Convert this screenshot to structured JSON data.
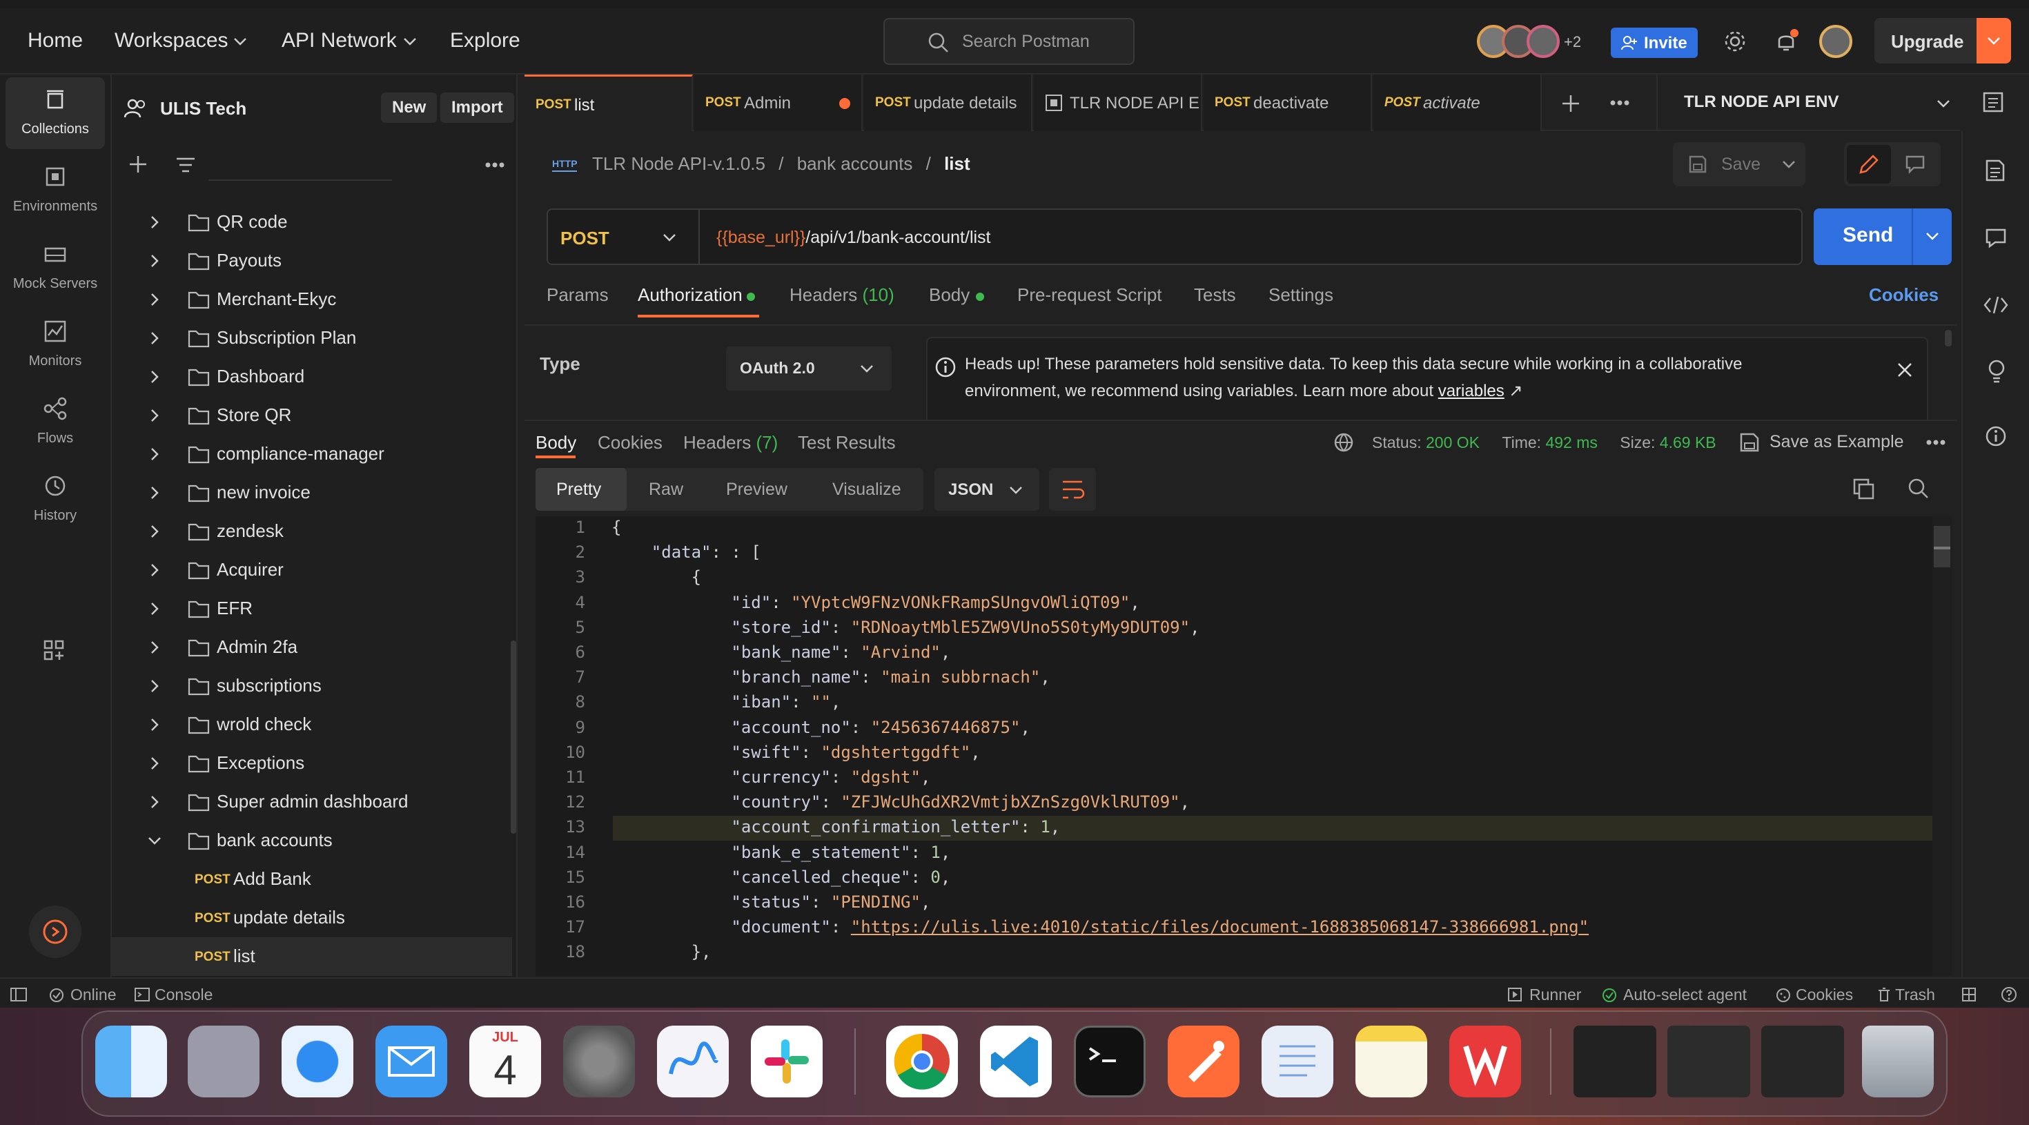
{
  "topnav": {
    "home": "Home",
    "workspaces": "Workspaces",
    "api_network": "API Network",
    "explore": "Explore",
    "search_placeholder": "Search Postman",
    "avatars_more": "+2",
    "invite": "Invite",
    "upgrade": "Upgrade"
  },
  "workspace": {
    "name": "ULIS Tech",
    "new": "New",
    "import": "Import"
  },
  "rail": [
    {
      "label": "Collections",
      "icon": "collections-icon"
    },
    {
      "label": "Environments",
      "icon": "environments-icon"
    },
    {
      "label": "Mock Servers",
      "icon": "mock-servers-icon"
    },
    {
      "label": "Monitors",
      "icon": "monitors-icon"
    },
    {
      "label": "Flows",
      "icon": "flows-icon"
    },
    {
      "label": "History",
      "icon": "history-icon"
    }
  ],
  "tree": {
    "folders": [
      "QR code",
      "Payouts",
      "Merchant-Ekyc",
      "Subscription Plan",
      "Dashboard",
      "Store QR",
      "compliance-manager",
      "new invoice",
      "zendesk",
      "Acquirer",
      "EFR",
      "Admin 2fa",
      "subscriptions",
      "wrold check",
      "Exceptions",
      "Super admin dashboard",
      "bank accounts"
    ],
    "requests": [
      {
        "method": "POST",
        "name": "Add Bank"
      },
      {
        "method": "POST",
        "name": "update details"
      },
      {
        "method": "POST",
        "name": "list"
      }
    ]
  },
  "tabs": [
    {
      "method": "POST",
      "name": "list"
    },
    {
      "method": "POST",
      "name": "Admin"
    },
    {
      "method": "POST",
      "name": "update details"
    },
    {
      "method": "",
      "name": "TLR NODE API E"
    },
    {
      "method": "POST",
      "name": "deactivate"
    },
    {
      "method": "POST",
      "name": "activate"
    }
  ],
  "environment": "TLR NODE API ENV",
  "breadcrumb": {
    "collection": "TLR Node API-v.1.0.5",
    "folder": "bank accounts",
    "request": "list",
    "sep": "/"
  },
  "save": "Save",
  "request": {
    "method": "POST",
    "url_var": "{{base_url}}",
    "url_path": "/api/v1/bank-account/list",
    "send": "Send"
  },
  "req_tabs": {
    "params": "Params",
    "authorization": "Authorization",
    "headers": "Headers",
    "headers_count": "(10)",
    "body": "Body",
    "prescript": "Pre-request Script",
    "tests": "Tests",
    "settings": "Settings",
    "cookies": "Cookies"
  },
  "auth": {
    "type_label": "Type",
    "type_value": "OAuth 2.0",
    "notice_line1": "Heads up! These parameters hold sensitive data. To keep this data secure while working in a collaborative",
    "notice_line2": "environment, we recommend using variables. Learn more about",
    "notice_link": "variables",
    "notice_arrow": "↗"
  },
  "response": {
    "tabs": {
      "body": "Body",
      "cookies": "Cookies",
      "headers": "Headers",
      "headers_count": "(7)",
      "tests": "Test Results"
    },
    "status_label": "Status:",
    "status": "200 OK",
    "time_label": "Time:",
    "time": "492 ms",
    "size_label": "Size:",
    "size": "4.69 KB",
    "save_example": "Save as Example",
    "views": {
      "pretty": "Pretty",
      "raw": "Raw",
      "preview": "Preview",
      "visualize": "Visualize"
    },
    "format": "JSON"
  },
  "code": [
    {
      "n": "1",
      "indent": "",
      "text": "{"
    },
    {
      "n": "2",
      "indent": "    ",
      "key": "\"data\"",
      "text": ": ["
    },
    {
      "n": "3",
      "indent": "        ",
      "text": "{"
    },
    {
      "n": "4",
      "indent": "            ",
      "key": "\"id\"",
      "val": "\"YVptcW9FNzVONkFRampSUngvOWliQT09\"",
      "end": ","
    },
    {
      "n": "5",
      "indent": "            ",
      "key": "\"store_id\"",
      "val": "\"RDNoaytMblE5ZW9VUno5S0tyMy9DUT09\"",
      "end": ","
    },
    {
      "n": "6",
      "indent": "            ",
      "key": "\"bank_name\"",
      "val": "\"Arvind\"",
      "end": ","
    },
    {
      "n": "7",
      "indent": "            ",
      "key": "\"branch_name\"",
      "val": "\"main subbrnach\"",
      "end": ","
    },
    {
      "n": "8",
      "indent": "            ",
      "key": "\"iban\"",
      "val": "\"\"",
      "end": ","
    },
    {
      "n": "9",
      "indent": "            ",
      "key": "\"account_no\"",
      "val": "\"2456367446875\"",
      "end": ","
    },
    {
      "n": "10",
      "indent": "            ",
      "key": "\"swift\"",
      "val": "\"dgshtertggdft\"",
      "end": ","
    },
    {
      "n": "11",
      "indent": "            ",
      "key": "\"currency\"",
      "val": "\"dgsht\"",
      "end": ","
    },
    {
      "n": "12",
      "indent": "            ",
      "key": "\"country\"",
      "val": "\"ZFJWcUhGdXR2VmtjbXZnSzg0VklRUT09\"",
      "end": ","
    },
    {
      "n": "13",
      "indent": "            ",
      "key": "\"account_confirmation_letter\"",
      "num": "1",
      "end": ","
    },
    {
      "n": "14",
      "indent": "            ",
      "key": "\"bank_e_statement\"",
      "num": "1",
      "end": ","
    },
    {
      "n": "15",
      "indent": "            ",
      "key": "\"cancelled_cheque\"",
      "num": "0",
      "end": ","
    },
    {
      "n": "16",
      "indent": "            ",
      "key": "\"status\"",
      "val": "\"PENDING\"",
      "end": ","
    },
    {
      "n": "17",
      "indent": "            ",
      "key": "\"document\"",
      "val": "\"https://ulis.live:4010/static/files/document-1688385068147-338666981.png\"",
      "end": ""
    },
    {
      "n": "18",
      "indent": "        ",
      "text": "},"
    }
  ],
  "statusbar": {
    "online": "Online",
    "console": "Console",
    "runner": "Runner",
    "agent": "Auto-select agent",
    "cookies": "Cookies",
    "trash": "Trash"
  },
  "dock": {
    "calendar_month": "JUL",
    "calendar_day": "4"
  },
  "colors": {
    "accent": "#ff6c37",
    "primary": "#2f6fe0",
    "post": "#f0c24b",
    "ok": "#3fb950"
  }
}
